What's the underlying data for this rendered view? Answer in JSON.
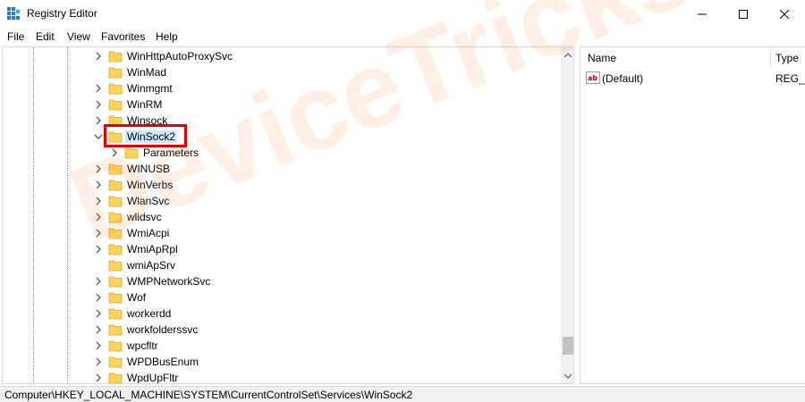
{
  "window": {
    "title": "Registry Editor",
    "minimize_icon": "minimize-icon",
    "maximize_icon": "maximize-icon",
    "close_icon": "close-icon"
  },
  "menu": [
    "File",
    "Edit",
    "View",
    "Favorites",
    "Help"
  ],
  "tree": {
    "items": [
      {
        "label": "WinHttpAutoProxySvc",
        "expander": "collapsed"
      },
      {
        "label": "WinMad",
        "expander": "none"
      },
      {
        "label": "Winmgmt",
        "expander": "collapsed"
      },
      {
        "label": "WinRM",
        "expander": "collapsed"
      },
      {
        "label": "Winsock",
        "expander": "collapsed"
      },
      {
        "label": "WinSock2",
        "expander": "expanded",
        "selected": true
      },
      {
        "label": "Parameters",
        "expander": "collapsed",
        "child": true
      },
      {
        "label": "WINUSB",
        "expander": "collapsed"
      },
      {
        "label": "WinVerbs",
        "expander": "collapsed"
      },
      {
        "label": "WlanSvc",
        "expander": "collapsed"
      },
      {
        "label": "wlidsvc",
        "expander": "collapsed"
      },
      {
        "label": "WmiAcpi",
        "expander": "collapsed"
      },
      {
        "label": "WmiApRpl",
        "expander": "collapsed"
      },
      {
        "label": "wmiApSrv",
        "expander": "none"
      },
      {
        "label": "WMPNetworkSvc",
        "expander": "collapsed"
      },
      {
        "label": "Wof",
        "expander": "collapsed"
      },
      {
        "label": "workerdd",
        "expander": "collapsed"
      },
      {
        "label": "workfolderssvc",
        "expander": "collapsed"
      },
      {
        "label": "wpcfltr",
        "expander": "collapsed"
      },
      {
        "label": "WPDBusEnum",
        "expander": "collapsed"
      },
      {
        "label": "WpdUpFltr",
        "expander": "collapsed"
      }
    ],
    "folder_color": "#ffd35c",
    "selection_color": "#cce8ff",
    "highlight_color": "#e00000"
  },
  "values_pane": {
    "columns": {
      "name": "Name",
      "type": "Type"
    },
    "rows": [
      {
        "name": "(Default)",
        "type": "REG_S",
        "icon": "string-value-icon"
      }
    ]
  },
  "status_bar": {
    "path": "Computer\\HKEY_LOCAL_MACHINE\\SYSTEM\\CurrentControlSet\\Services\\WinSock2"
  },
  "watermark": "DeviceTricks"
}
